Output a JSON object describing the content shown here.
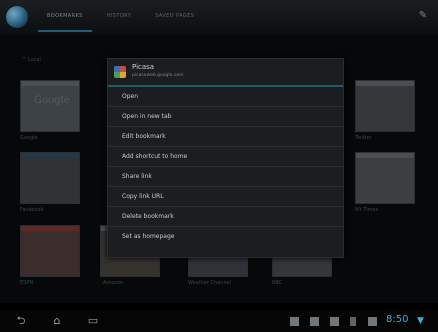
{
  "actionbar": {
    "tabs": [
      "BOOKMARKS",
      "HISTORY",
      "SAVED PAGES"
    ]
  },
  "content": {
    "folder_label": "^ Local",
    "thumbnails": [
      {
        "label": "Google",
        "logo": "Google"
      },
      {
        "label": "",
        "logo": ""
      },
      {
        "label": "Twitter",
        "logo": ""
      },
      {
        "label": "Facebook",
        "logo": ""
      },
      {
        "label": "",
        "logo": ""
      },
      {
        "label": "NY Times",
        "logo": ""
      },
      {
        "label": "ESPN",
        "logo": ""
      },
      {
        "label": "Amazon",
        "logo": ""
      },
      {
        "label": "Weather Channel",
        "logo": ""
      },
      {
        "label": "BBC",
        "logo": ""
      }
    ]
  },
  "menu": {
    "title": "Picasa",
    "url": "picasaweb.google.com",
    "items": [
      "Open",
      "Open in new tab",
      "Edit bookmark",
      "Add shortcut to home",
      "Share link",
      "Copy link URL",
      "Delete bookmark",
      "Set as homepage"
    ]
  },
  "statusbar": {
    "time": "8:50",
    "back_icon": "back-icon",
    "home_icon": "home-icon",
    "recents_icon": "recents-icon"
  }
}
